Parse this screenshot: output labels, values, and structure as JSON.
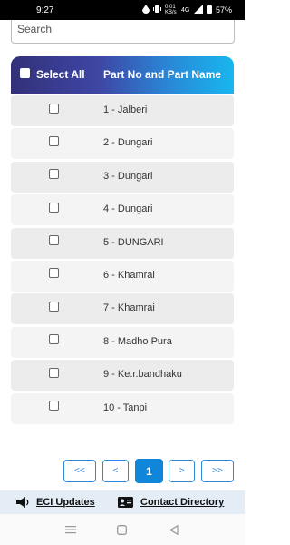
{
  "status_bar": {
    "time": "9:27",
    "speed": "0.01 KB/s",
    "battery": "57%"
  },
  "search": {
    "placeholder": "Search"
  },
  "table": {
    "select_all_label": "Select All",
    "column_header": "Part No and Part Name",
    "rows": [
      {
        "label": "1 - Jalberi"
      },
      {
        "label": "2 - Dungari"
      },
      {
        "label": "3 - Dungari"
      },
      {
        "label": "4 - Dungari"
      },
      {
        "label": "5 - DUNGARI"
      },
      {
        "label": "6 - Khamrai"
      },
      {
        "label": "7 - Khamrai"
      },
      {
        "label": "8 - Madho Pura"
      },
      {
        "label": "9 - Ke.r.bandhaku"
      },
      {
        "label": "10 - Tanpi"
      }
    ]
  },
  "pagination": {
    "first": "<<",
    "prev": "<",
    "current": "1",
    "next": ">",
    "last": ">>"
  },
  "footer": {
    "eci_updates": "ECI Updates",
    "contact_directory": "Contact Directory"
  },
  "colors": {
    "header_gradient_start": "#33307a",
    "header_gradient_end": "#17b7ee",
    "accent": "#0f86d9"
  }
}
